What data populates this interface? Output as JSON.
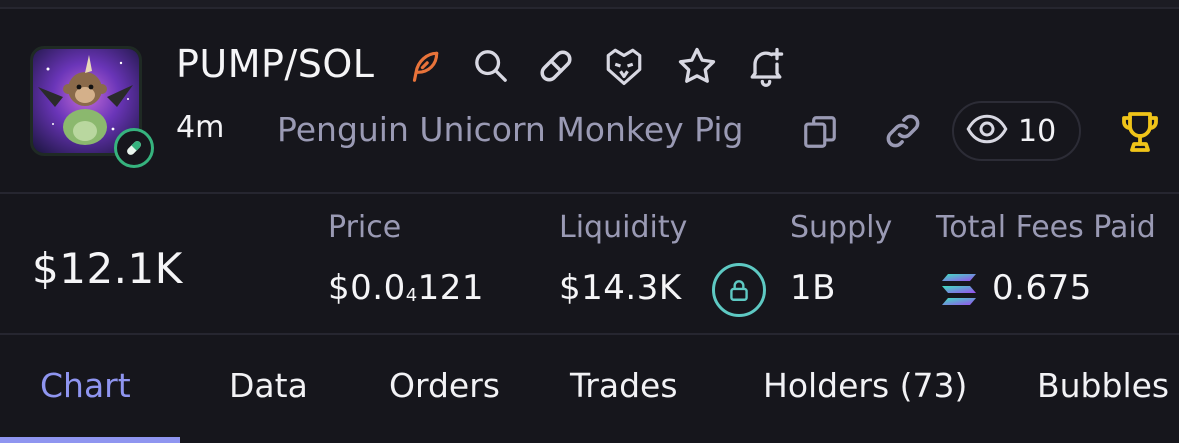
{
  "header": {
    "pair": "PUMP/SOL",
    "age": "4m",
    "token_name": "Penguin Unicorn Monkey Pig",
    "views": "10",
    "icons": [
      "feather-icon",
      "search-icon",
      "pill-icon",
      "eagle-icon",
      "star-icon",
      "bell-plus-icon",
      "copy-icon",
      "link-icon",
      "eye-icon",
      "trophy-icon"
    ]
  },
  "stats": {
    "market_cap": "$12.1K",
    "price_label": "Price",
    "price_prefix": "$0.0",
    "price_sub": "4",
    "price_suffix": "121",
    "liquidity_label": "Liquidity",
    "liquidity_value": "$14.3K",
    "supply_label": "Supply",
    "supply_value": "1B",
    "fees_label": "Total Fees Paid",
    "fees_value": "0.675"
  },
  "tabs": [
    {
      "label": "Chart",
      "active": true
    },
    {
      "label": "Data",
      "active": false
    },
    {
      "label": "Orders",
      "active": false
    },
    {
      "label": "Trades",
      "active": false
    },
    {
      "label": "Holders (73)",
      "active": false
    },
    {
      "label": "Bubbles",
      "active": false
    }
  ],
  "colors": {
    "background": "#16161c",
    "accent": "#8f95f0",
    "muted_text": "#9a9ab4",
    "feather": "#e8733a",
    "trophy": "#f0c419",
    "lock": "#5ec9c3",
    "pill_badge": "#36b37e"
  }
}
